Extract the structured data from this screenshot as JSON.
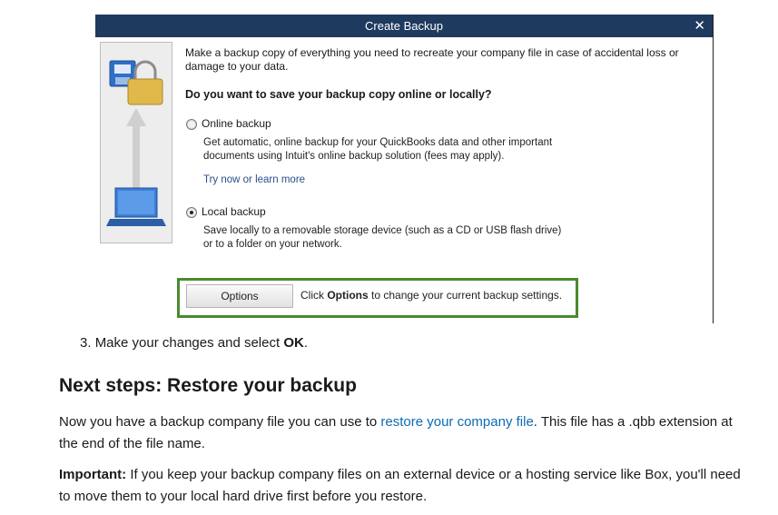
{
  "dialog": {
    "title": "Create Backup",
    "intro": "Make a backup copy of everything you need to recreate your company file in case of accidental loss or damage to your data.",
    "question": "Do you want to save your backup copy online or locally?",
    "online": {
      "label": "Online backup",
      "selected": false,
      "desc_line1": "Get automatic, online backup for your QuickBooks data and other important",
      "desc_line2": "documents using Intuit's online backup solution (fees may apply).",
      "link": "Try now or learn more"
    },
    "local": {
      "label": "Local backup",
      "selected": true,
      "desc_line1": "Save locally to a removable storage device (such as a CD or USB flash drive)",
      "desc_line2": "or to a folder on your network."
    },
    "options_button": "Options",
    "options_text_pre": "Click ",
    "options_text_bold": "Options",
    "options_text_post": " to change your current backup settings."
  },
  "article": {
    "step_number": "3.",
    "step_text": "Make your changes and select ",
    "step_bold": "OK",
    "step_end": ".",
    "heading": "Next steps: Restore your backup",
    "para1_pre": "Now you have a backup company file you can use to ",
    "para1_link": "restore your company file",
    "para1_post": ". This file has a .qbb extension at the end of the file name.",
    "para2_bold": "Important:",
    "para2_text": " If you keep your backup company files on an external device or a hosting service like Box, you'll need to move them to your local hard drive first before you restore."
  },
  "colors": {
    "titlebar": "#1e3a5f",
    "highlight_border": "#4a8a2e",
    "link": "#0a6bb8"
  }
}
